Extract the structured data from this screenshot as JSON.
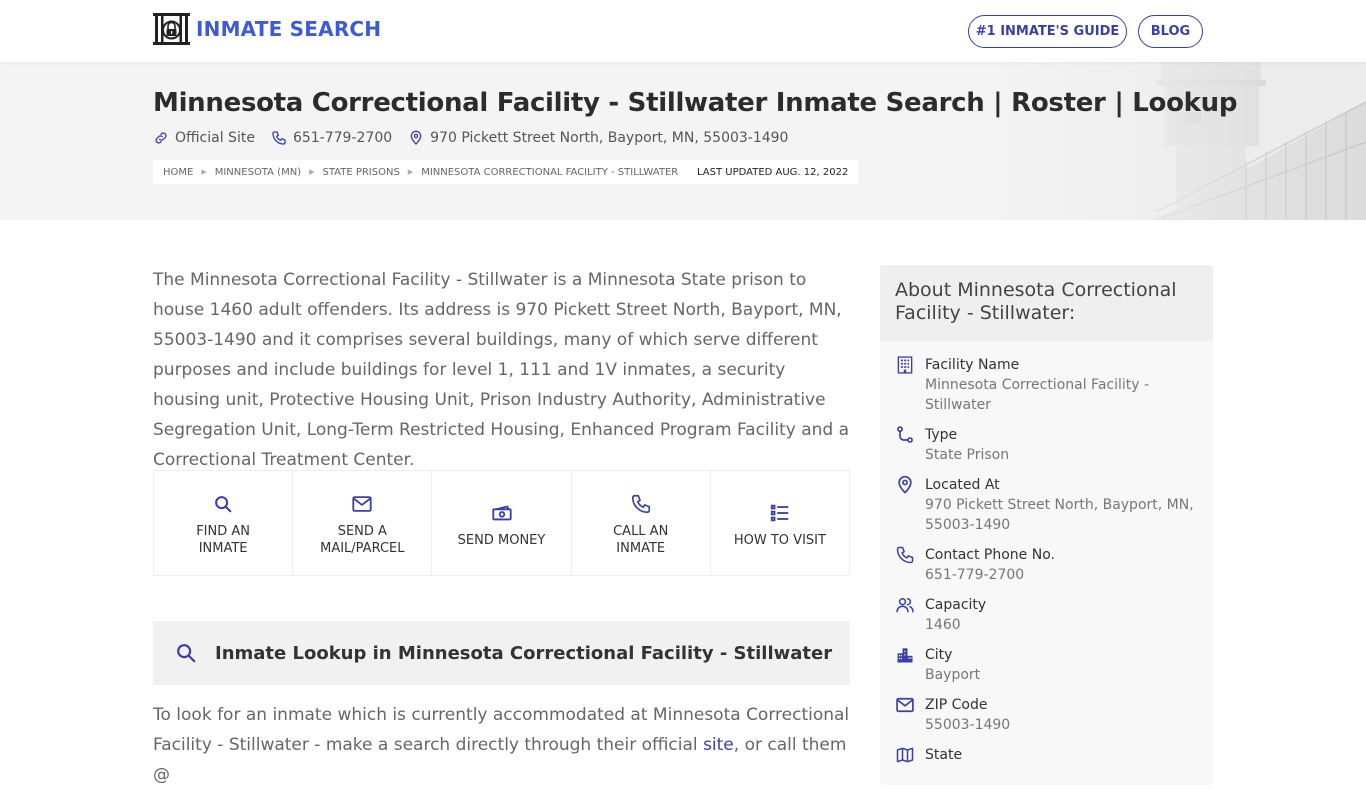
{
  "header": {
    "logo_text": "INMATE SEARCH",
    "nav": [
      {
        "label": "#1 INMATE'S GUIDE"
      },
      {
        "label": "BLOG"
      }
    ]
  },
  "hero": {
    "title": "Minnesota Correctional Facility - Stillwater Inmate Search | Roster | Lookup",
    "official_site_label": "Official Site",
    "phone": "651-779-2700",
    "address": "970 Pickett Street North, Bayport, MN, 55003-1490",
    "breadcrumb": [
      {
        "label": "HOME"
      },
      {
        "label": "MINNESOTA (MN)"
      },
      {
        "label": "STATE PRISONS"
      },
      {
        "label": "MINNESOTA CORRECTIONAL FACILITY - STILLWATER"
      }
    ],
    "last_updated": "LAST UPDATED AUG. 12, 2022"
  },
  "main": {
    "intro": "The Minnesota Correctional Facility - Stillwater is a Minnesota State prison to house 1460 adult offenders. Its address is 970 Pickett Street North, Bayport, MN, 55003-1490 and it comprises several buildings, many of which serve different purposes and include buildings for level 1, 111 and 1V inmates, a security housing unit, Protective Housing Unit, Prison Industry Authority, Administrative Segregation Unit, Long-Term Restricted Housing, Enhanced Program Facility and a Correctional Treatment Center.",
    "actions": [
      {
        "label_line1": "FIND AN",
        "label_line2": "INMATE",
        "icon": "search-icon"
      },
      {
        "label_line1": "SEND A",
        "label_line2": "MAIL/PARCEL",
        "icon": "mail-icon"
      },
      {
        "label_line1": "SEND MONEY",
        "label_line2": "",
        "icon": "money-icon"
      },
      {
        "label_line1": "CALL AN",
        "label_line2": "INMATE",
        "icon": "phone-icon"
      },
      {
        "label_line1": "HOW TO VISIT",
        "label_line2": "",
        "icon": "list-icon"
      }
    ],
    "lookup_title": "Inmate Lookup in Minnesota Correctional Facility - Stillwater",
    "lookup_text_before": "To look for an inmate which is currently accommodated at Minnesota Correctional Facility - Stillwater - make a search directly through their official ",
    "lookup_link": "site",
    "lookup_text_after": ", or call them @"
  },
  "sidebar": {
    "title": "About Minnesota Correctional Facility - Stillwater:",
    "items": [
      {
        "label": "Facility Name",
        "value": "Minnesota Correctional Facility - Stillwater",
        "icon": "building-icon"
      },
      {
        "label": "Type",
        "value": "State Prison",
        "icon": "route-icon"
      },
      {
        "label": "Located At",
        "value": "970 Pickett Street North, Bayport, MN, 55003-1490",
        "icon": "map-pin-icon"
      },
      {
        "label": "Contact Phone No.",
        "value": "651-779-2700",
        "icon": "phone-icon"
      },
      {
        "label": "Capacity",
        "value": "1460",
        "icon": "users-icon"
      },
      {
        "label": "City",
        "value": "Bayport",
        "icon": "city-icon"
      },
      {
        "label": "ZIP Code",
        "value": "55003-1490",
        "icon": "mail-icon"
      },
      {
        "label": "State",
        "value": "",
        "icon": "map-icon"
      }
    ]
  },
  "colors": {
    "brand": "#3d5bd9",
    "accent": "#3a3fa8",
    "text": "#333333",
    "muted": "#666666"
  }
}
